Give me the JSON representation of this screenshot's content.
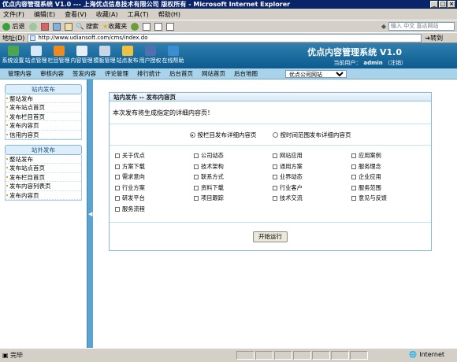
{
  "window": {
    "title": "优点内容管理系统 V1.0 --- 上海优点信息技术有限公司 版权所有 - Microsoft Internet Explorer"
  },
  "menubar": [
    "文件(F)",
    "编辑(E)",
    "查看(V)",
    "收藏(A)",
    "工具(T)",
    "帮助(H)"
  ],
  "toolbar": {
    "back": "后退",
    "search": "搜索",
    "favorites": "收藏夹",
    "search_placeholder": "输入 中文 直达网站"
  },
  "address": {
    "label": "地址(D)",
    "url": "http://www.udiansoft.com/cms/index.do",
    "go": "转到"
  },
  "header": {
    "brand": "优点内容管理系统 V1.0",
    "user_label": "当前用户：",
    "user": "admin",
    "logout": "（注销）",
    "nav": [
      "系统设置",
      "站点管理",
      "栏目管理",
      "内容管理",
      "模板管理",
      "站点发布",
      "用户授权",
      "在线帮助"
    ]
  },
  "subnav": {
    "items": [
      "管理内容",
      "审核内容",
      "签发内容",
      "评论管理",
      "排行统计",
      "后台首页",
      "网站首页",
      "后台地图"
    ],
    "select_value": "优点公司网站"
  },
  "sidebar": {
    "section1": {
      "title": "站内发布",
      "items": [
        "整站发布",
        "发布站点首页",
        "发布栏目首页",
        "发布内容页",
        "信用内容页"
      ]
    },
    "section2": {
      "title": "站外发布",
      "items": [
        "整站发布",
        "发布站点首页",
        "发布栏目首页",
        "发布内容列表页",
        "发布内容页"
      ]
    }
  },
  "panel": {
    "title": "站内发布 -- 发布内容页",
    "desc": "本次发布将生成指定的详细内容页！",
    "radio1": "按栏目发布详细内容页",
    "radio2": "按时间范围发布详细内容页",
    "checkboxes": [
      "关于优点",
      "公司动态",
      "网站应用",
      "应用案例",
      "方案下载",
      "技术架构",
      "通用方案",
      "服务理念",
      "需求意向",
      "联系方式",
      "业界动态",
      "企业应用",
      "行业方案",
      "资料下载",
      "行业客户",
      "服务范围",
      "研发平台",
      "项目跟踪",
      "技术交流",
      "意见与反馈",
      "服务流程"
    ],
    "button": "开始运行"
  },
  "status": {
    "left": "完毕",
    "zone": "Internet"
  }
}
